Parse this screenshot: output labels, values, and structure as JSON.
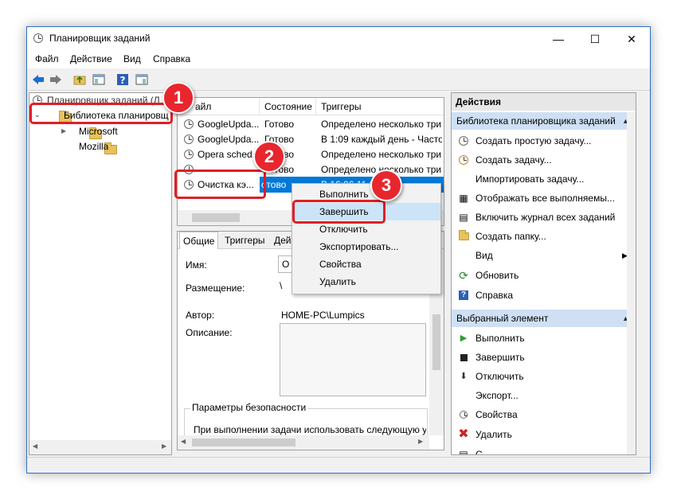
{
  "window": {
    "title": "Планировщик заданий"
  },
  "menu": [
    "Файл",
    "Действие",
    "Вид",
    "Справка"
  ],
  "tree": {
    "root_label": "Планировщик заданий (Л",
    "library_label": "Библиотека планировщ",
    "children": [
      "Microsoft",
      "Mozilla"
    ]
  },
  "tasks": {
    "headers": [
      "Имя файла",
      "Состояние",
      "Триггеры"
    ],
    "header_shown_name": "айл",
    "rows": [
      {
        "name": "GoogleUpda...",
        "status": "Готово",
        "trigger": "Определено несколько триг"
      },
      {
        "name": "GoogleUpda...",
        "status": "Готово",
        "trigger": "В 1:09 каждый день - Частот"
      },
      {
        "name": "Opera sched...",
        "status": "Готово",
        "trigger": "Определено несколько триг"
      },
      {
        "name": "",
        "status": "Готово",
        "trigger": "Определено несколько триг"
      },
      {
        "name": "Очистка кэ...",
        "status": "отово",
        "trigger": "В 16:06 11.0"
      }
    ]
  },
  "context_menu": [
    "Выполнить",
    "Завершить",
    "Отключить",
    "Экспортировать...",
    "Свойства",
    "Удалить"
  ],
  "details": {
    "tabs": [
      "Общие",
      "Триггеры",
      "Дей"
    ],
    "name_label": "Имя:",
    "name_value": "О",
    "location_label": "Размещение:",
    "location_value": "\\",
    "author_label": "Автор:",
    "author_value": "HOME-PC\\Lumpics",
    "description_label": "Описание:",
    "security_title": "Параметры безопасности",
    "security_text": "При выполнении задачи использовать следующую у"
  },
  "actions": {
    "title": "Действия",
    "section1": "Библиотека планировщика заданий",
    "items1": [
      "Создать простую задачу...",
      "Создать задачу...",
      "Импортировать задачу...",
      "Отображать все выполняемы...",
      "Включить журнал всех заданий",
      "Создать папку...",
      "Вид",
      "Обновить",
      "Справка"
    ],
    "section2": "Выбранный элемент",
    "items2": [
      "Выполнить",
      "Завершить",
      "Отключить",
      "Экспорт...",
      "Свойства",
      "Удалить",
      "С"
    ]
  },
  "badges": [
    "1",
    "2",
    "3"
  ],
  "colors": {
    "accent": "#0078d7",
    "highlight": "#e01e26",
    "section_bg": "#cfe0f5"
  }
}
